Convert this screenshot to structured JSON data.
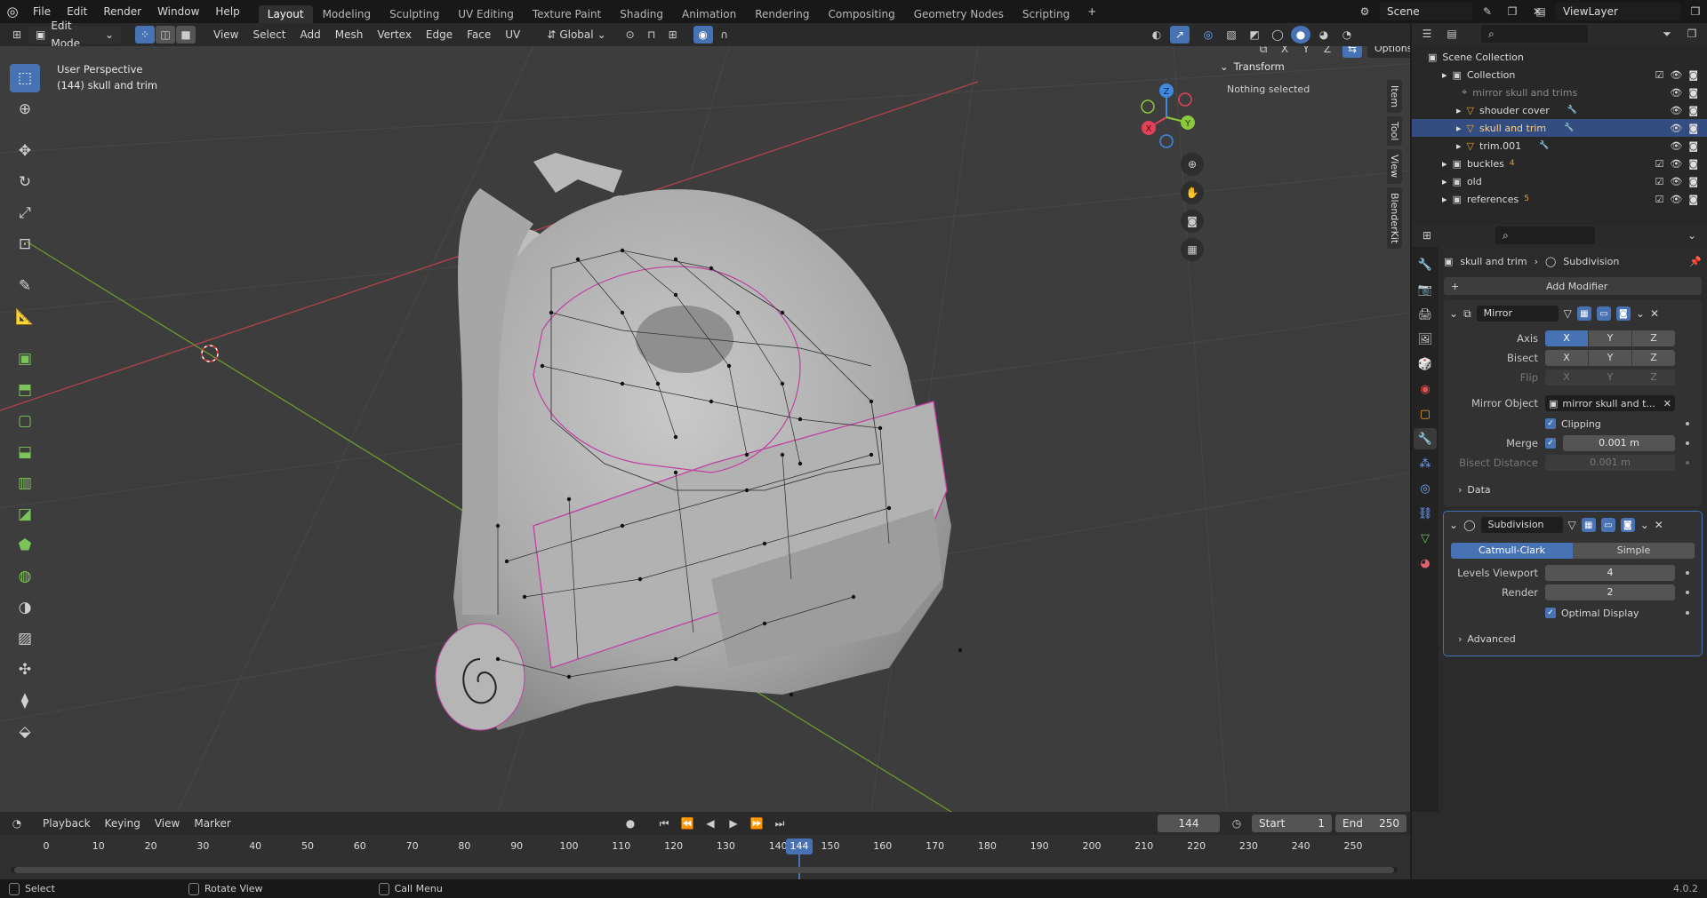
{
  "menu": {
    "items": [
      "File",
      "Edit",
      "Render",
      "Window",
      "Help"
    ]
  },
  "workspaces": {
    "tabs": [
      "Layout",
      "Modeling",
      "Sculpting",
      "UV Editing",
      "Texture Paint",
      "Shading",
      "Animation",
      "Rendering",
      "Compositing",
      "Geometry Nodes",
      "Scripting"
    ],
    "active": "Layout",
    "add": "+"
  },
  "scene": {
    "name": "Scene"
  },
  "view_layer": {
    "name": "ViewLayer"
  },
  "viewport": {
    "mode": "Edit Mode",
    "menus": [
      "View",
      "Select",
      "Add",
      "Mesh",
      "Vertex",
      "Edge",
      "Face",
      "UV"
    ],
    "transform_orientation": "Global",
    "perspective": "User Perspective",
    "object_label": "(144) skull and trim",
    "axes": [
      "X",
      "Y",
      "Z"
    ],
    "options": "Options",
    "side_tabs": [
      "Item",
      "Tool",
      "View",
      "BlenderKit"
    ]
  },
  "transform_panel": {
    "title": "Transform",
    "message": "Nothing selected"
  },
  "gizmo": {
    "x": "X",
    "y": "Y",
    "z": "Z",
    "colors": {
      "x": "#e3415b",
      "y": "#8bc83b",
      "z": "#3f89e1"
    }
  },
  "outliner": {
    "scene_collection": "Scene Collection",
    "rows": [
      {
        "name": "Collection",
        "indent": 1,
        "type": "collection"
      },
      {
        "name": "mirror skull and trims",
        "indent": 2,
        "type": "empty",
        "dim": true
      },
      {
        "name": "shouder cover",
        "indent": 2,
        "type": "mesh"
      },
      {
        "name": "skull and trim",
        "indent": 2,
        "type": "mesh",
        "selected": true
      },
      {
        "name": "trim.001",
        "indent": 2,
        "type": "mesh"
      },
      {
        "name": "buckles",
        "indent": 1,
        "type": "collection",
        "badge": "4"
      },
      {
        "name": "old",
        "indent": 1,
        "type": "collection"
      },
      {
        "name": "references",
        "indent": 1,
        "type": "collection",
        "badge": "5"
      }
    ]
  },
  "properties": {
    "breadcrumb_object": "skull and trim",
    "breadcrumb_modifier": "Subdivision",
    "add_modifier": "Add Modifier",
    "mirror": {
      "name": "Mirror",
      "axis_label": "Axis",
      "bisect_label": "Bisect",
      "flip_label": "Flip",
      "axes": [
        "X",
        "Y",
        "Z"
      ],
      "mirror_object_label": "Mirror Object",
      "mirror_object_value": "mirror skull and t...",
      "clipping": "Clipping",
      "merge_label": "Merge",
      "merge_value": "0.001 m",
      "bisect_distance_label": "Bisect Distance",
      "bisect_distance_value": "0.001 m",
      "data": "Data"
    },
    "subdivision": {
      "name": "Subdivision",
      "catmull": "Catmull-Clark",
      "simple": "Simple",
      "levels_label": "Levels Viewport",
      "levels_value": "4",
      "render_label": "Render",
      "render_value": "2",
      "optimal": "Optimal Display",
      "advanced": "Advanced"
    }
  },
  "timeline": {
    "menus": [
      "Playback",
      "Keying",
      "View",
      "Marker"
    ],
    "current_frame": "144",
    "start_label": "Start",
    "start_value": "1",
    "end_label": "End",
    "end_value": "250",
    "ticks": [
      "0",
      "10",
      "20",
      "30",
      "40",
      "50",
      "60",
      "70",
      "80",
      "90",
      "100",
      "110",
      "120",
      "130",
      "140",
      "150",
      "160",
      "170",
      "180",
      "190",
      "200",
      "210",
      "220",
      "230",
      "240",
      "250"
    ],
    "playhead": "144"
  },
  "statusbar": {
    "select": "Select",
    "rotate": "Rotate View",
    "call_menu": "Call Menu",
    "version": "4.0.2"
  }
}
